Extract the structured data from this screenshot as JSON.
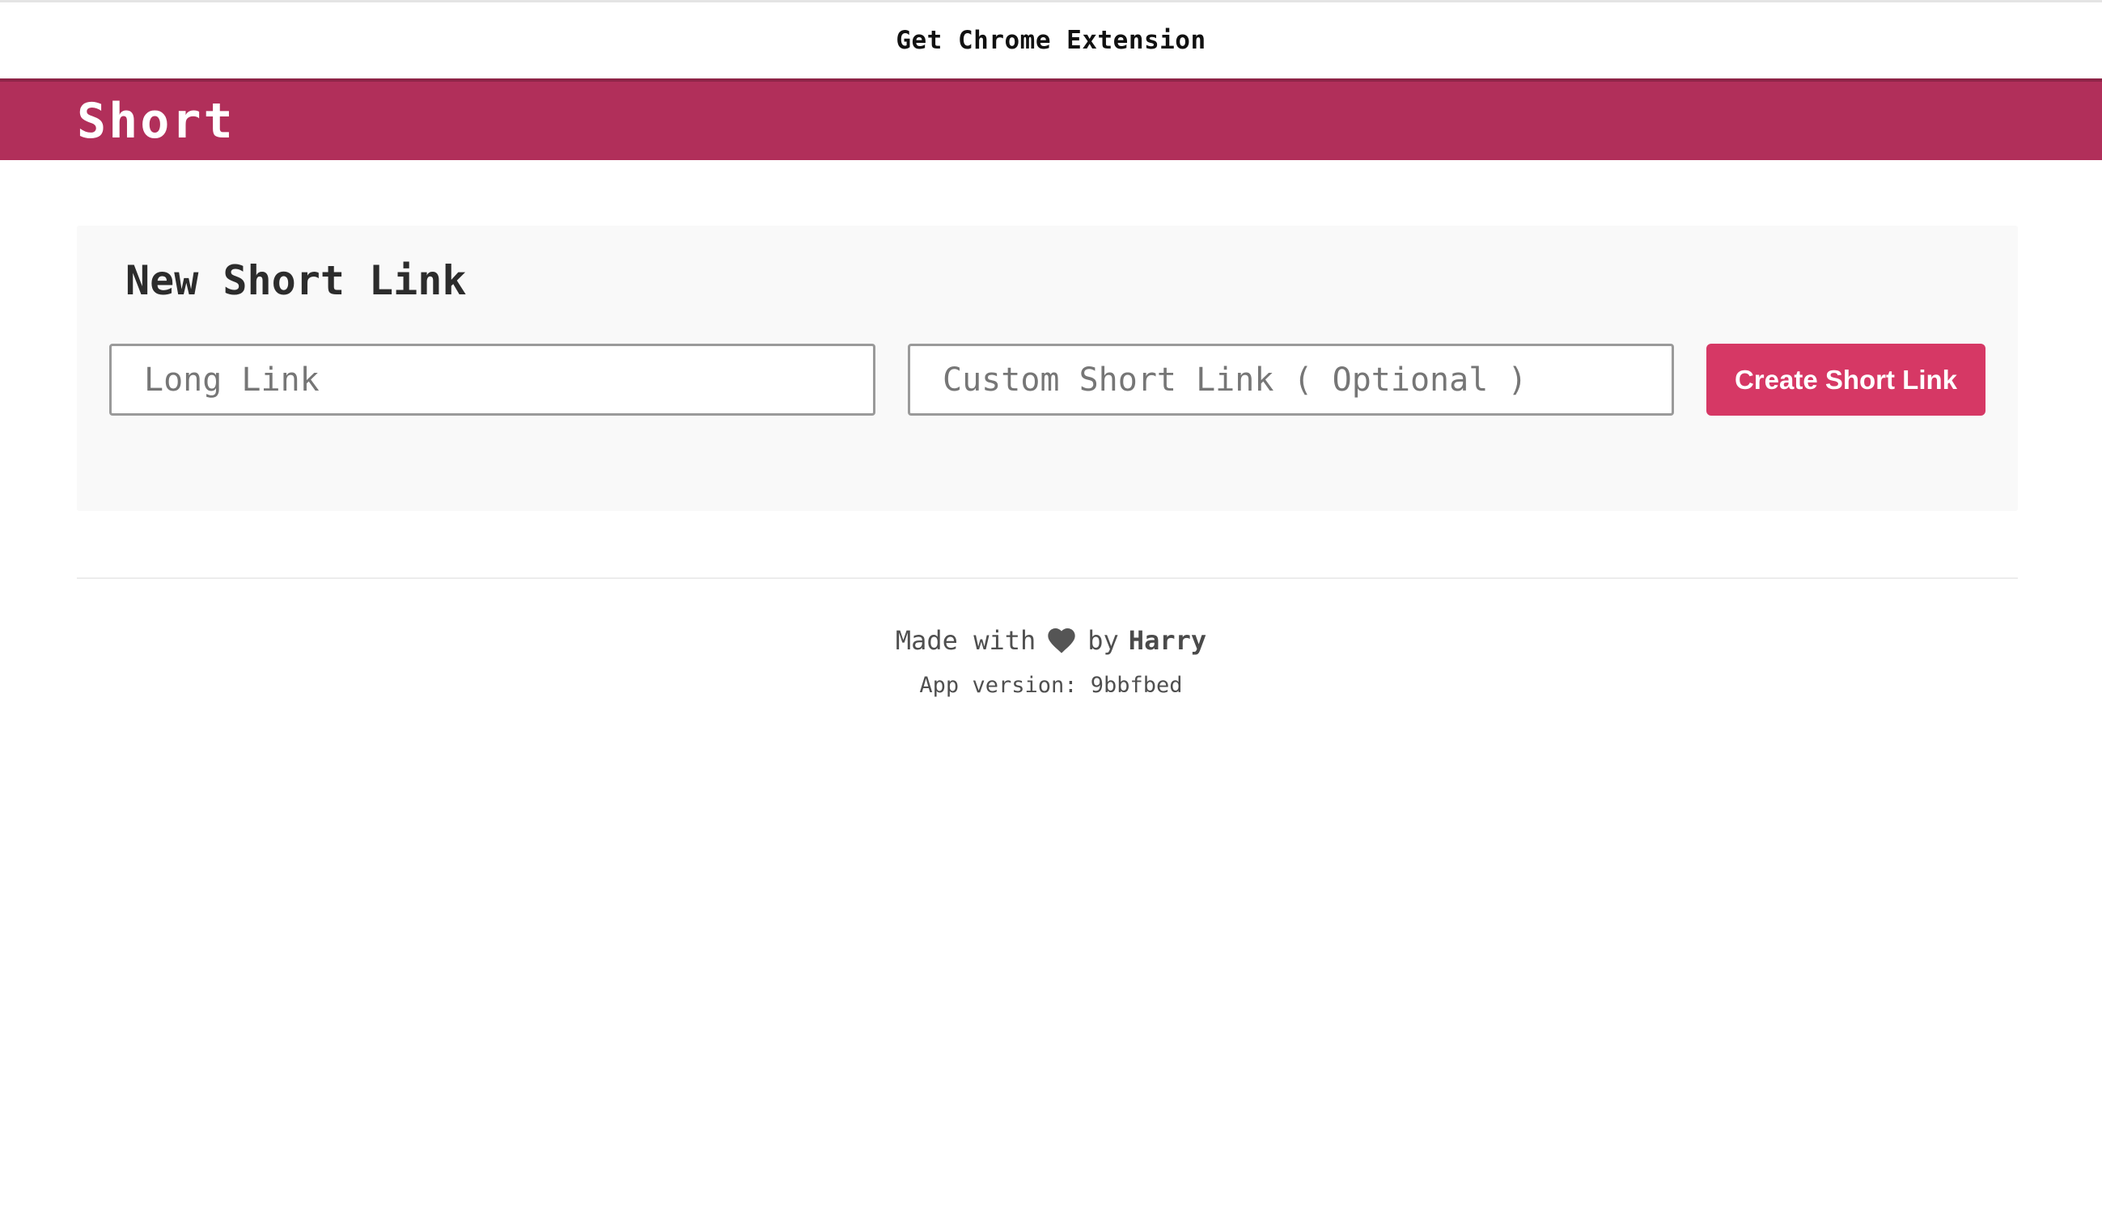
{
  "top_bar": {
    "extension_link": "Get Chrome Extension"
  },
  "header": {
    "brand": "Short",
    "brand_color": "#b12f5a"
  },
  "new_link_card": {
    "title": "New Short Link",
    "long_link": {
      "value": "",
      "placeholder": "Long Link"
    },
    "custom_link": {
      "value": "",
      "placeholder": "Custom Short Link ( Optional )"
    },
    "create_button_label": "Create Short Link",
    "create_button_color": "#d63865"
  },
  "footer": {
    "made_with": "Made with",
    "heart_icon": "heart-icon",
    "by": "by",
    "author": "Harry",
    "version_label": "App version:",
    "version_value": "9bbfbed"
  }
}
